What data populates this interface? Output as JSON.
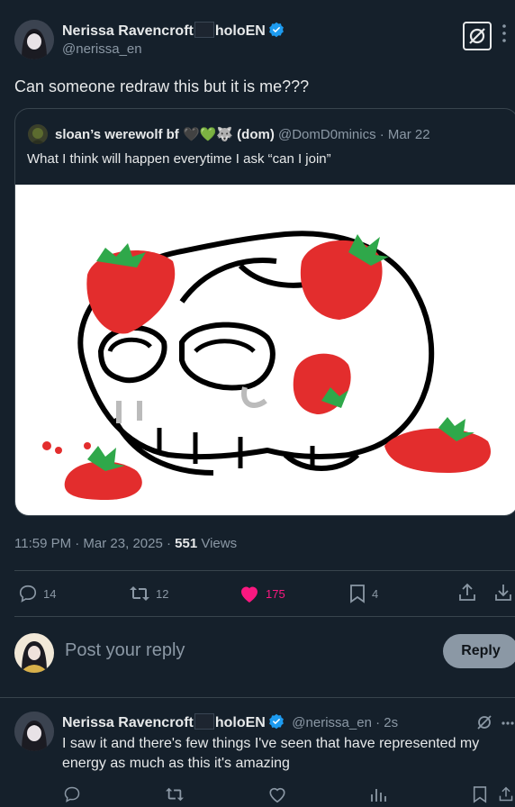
{
  "tweet": {
    "author": {
      "name_prefix": "Nerissa Ravencroft",
      "name_suffix": "holoEN",
      "handle": "@nerissa_en"
    },
    "text": "Can someone redraw this but it is me???",
    "quote": {
      "name": "sloan’s werewolf bf 🖤💚🐺 (dom)",
      "handle": "@DomD0minics",
      "time": "· Mar 22",
      "text": "What I think will happen everytime I ask “can I join”"
    },
    "timestamp": "11:59 PM · Mar 23, 2025 · ",
    "views_count": "551",
    "views_label": " Views",
    "stats": {
      "replies": "14",
      "retweets": "12",
      "likes": "175",
      "bookmarks": "4"
    }
  },
  "compose": {
    "placeholder": "Post your reply",
    "button": "Reply"
  },
  "reply": {
    "name_prefix": "Nerissa Ravencroft",
    "name_suffix": "holoEN",
    "handle": "@nerissa_en · 2s",
    "text": "I saw it and there's few things I've seen that have represented my energy as much as this it's amazing"
  },
  "colors": {
    "background": "#15202b",
    "like": "#f91880",
    "verified": "#1d9bf0",
    "strawberry": "#e32d2d"
  }
}
